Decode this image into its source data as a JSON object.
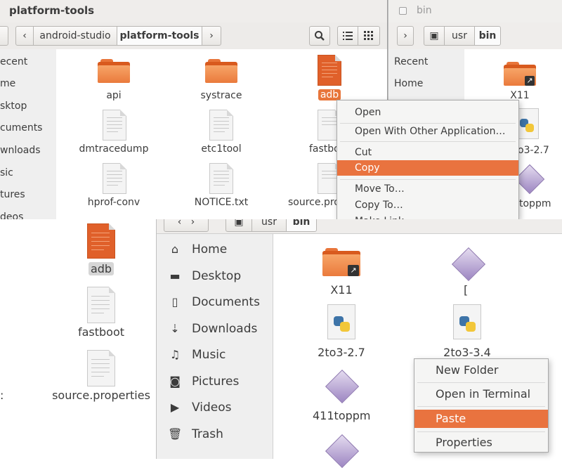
{
  "window_main": {
    "title": "platform-tools",
    "breadcrumb": [
      "android-studio",
      "platform-tools"
    ],
    "back_glyph": "‹",
    "forward_glyph": "›",
    "sidebar": [
      "Recent",
      "Home",
      "Desktop",
      "Documents",
      "Downloads",
      "Music",
      "Pictures",
      "Videos"
    ],
    "sidebar_visible": [
      "ecent",
      "me",
      "sktop",
      "cuments",
      "wnloads",
      "sic",
      "tures",
      "deos"
    ],
    "files": [
      {
        "name": "api",
        "icon": "folder-icon"
      },
      {
        "name": "systrace",
        "icon": "folder-icon"
      },
      {
        "name": "adb",
        "icon": "executable-icon"
      },
      {
        "name": "dmtracedump",
        "icon": "file-icon"
      },
      {
        "name": "etc1tool",
        "icon": "file-icon"
      },
      {
        "name": "fastboo",
        "icon": "file-icon"
      },
      {
        "name": "hprof-conv",
        "icon": "file-icon"
      },
      {
        "name": "NOTICE.txt",
        "icon": "file-icon"
      },
      {
        "name": "source.pro",
        "icon": "file-icon"
      }
    ]
  },
  "context_menu_file": {
    "items": [
      "Open",
      "Open With Other Application…",
      "Cut",
      "Copy",
      "Move To…",
      "Copy To…",
      "Make Link"
    ],
    "highlighted": "Copy",
    "colors": {
      "highlight": "#e9733f"
    }
  },
  "window_bin_top": {
    "title": "bin",
    "breadcrumb": [
      "usr",
      "bin"
    ],
    "sidebar": [
      "Recent",
      "Home"
    ],
    "files": [
      {
        "name": "X11",
        "icon": "folder-link-icon"
      },
      {
        "name": "o3-2.7",
        "icon": "python-icon"
      },
      {
        "name": "toppm",
        "icon": "diamond-icon"
      }
    ]
  },
  "zoom_left": {
    "files": [
      "adb",
      "fastboot",
      "source.properties"
    ],
    "colon": ":"
  },
  "window_bin_zoom": {
    "breadcrumb": [
      "usr",
      "bin"
    ],
    "sidebar": [
      {
        "label": "Home",
        "icon": "home-icon",
        "glyph": "⌂"
      },
      {
        "label": "Desktop",
        "icon": "desktop-icon",
        "glyph": "▬"
      },
      {
        "label": "Documents",
        "icon": "document-icon",
        "glyph": "▯"
      },
      {
        "label": "Downloads",
        "icon": "download-icon",
        "glyph": "⇣"
      },
      {
        "label": "Music",
        "icon": "music-icon",
        "glyph": "♫"
      },
      {
        "label": "Pictures",
        "icon": "camera-icon",
        "glyph": "◙"
      },
      {
        "label": "Videos",
        "icon": "video-icon",
        "glyph": "▶"
      },
      {
        "label": "Trash",
        "icon": "trash-icon",
        "glyph": "🗑"
      }
    ],
    "files": [
      {
        "name": "X11",
        "icon": "folder-link-icon"
      },
      {
        "name": "[",
        "icon": "diamond-icon"
      },
      {
        "name": "2to3-2.7",
        "icon": "python-icon"
      },
      {
        "name": "2to3-3.4",
        "icon": "python-icon"
      },
      {
        "name": "411toppm",
        "icon": "diamond-icon"
      }
    ]
  },
  "context_menu_background": {
    "items": [
      "New Folder",
      "Open in Terminal",
      "Paste",
      "Properties"
    ],
    "highlighted": "Paste"
  },
  "colors": {
    "accent": "#e9733f",
    "folder": "#e8753a",
    "sidebar_bg": "#efefef"
  }
}
